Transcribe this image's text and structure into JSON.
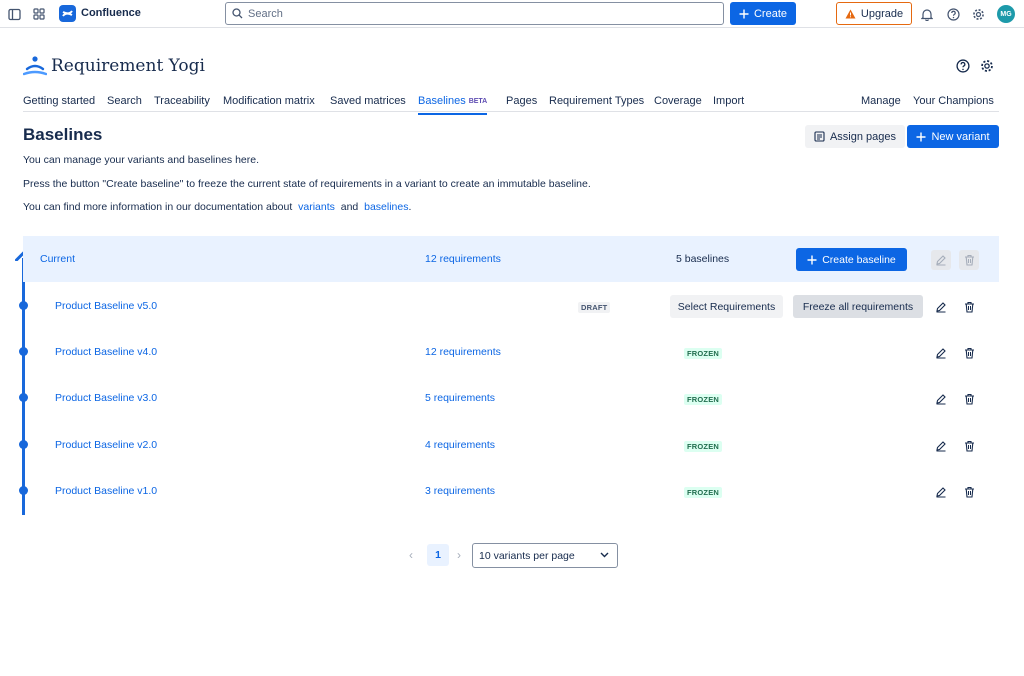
{
  "topbar": {
    "brand": "Confluence",
    "search_placeholder": "Search",
    "create_label": "Create",
    "upgrade_label": "Upgrade",
    "avatar_initials": "MG"
  },
  "app": {
    "name": "Requirement Yogi"
  },
  "tabs": [
    {
      "label": "Getting started"
    },
    {
      "label": "Search"
    },
    {
      "label": "Traceability"
    },
    {
      "label": "Modification matrix"
    },
    {
      "label": "Saved matrices"
    },
    {
      "label": "Baselines",
      "badge": "BETA",
      "active": true
    },
    {
      "label": "Pages"
    },
    {
      "label": "Requirement Types"
    },
    {
      "label": "Coverage"
    },
    {
      "label": "Import"
    },
    {
      "label": "Manage"
    },
    {
      "label": "Your Champions"
    }
  ],
  "page": {
    "title": "Baselines",
    "assign_pages_label": "Assign pages",
    "new_variant_label": "New variant",
    "intro_1": "You can manage your variants and baselines here.",
    "intro_2": "Press the button \"Create baseline\" to freeze the current state of requirements in a variant to create an immutable baseline.",
    "intro_3_prefix": "You can find more information in our documentation about",
    "intro_3_link1": "variants",
    "intro_3_and": "and",
    "intro_3_link2": "baselines",
    "intro_3_suffix": "."
  },
  "current": {
    "name": "Current",
    "requirements": "12 requirements",
    "baselines": "5 baselines",
    "create_baseline_label": "Create baseline"
  },
  "baselines": [
    {
      "name": "Product Baseline v5.0",
      "requirements": "",
      "status": "DRAFT",
      "select_label": "Select Requirements",
      "freeze_label": "Freeze all requirements"
    },
    {
      "name": "Product Baseline v4.0",
      "requirements": "12 requirements",
      "status": "FROZEN"
    },
    {
      "name": "Product Baseline v3.0",
      "requirements": "5 requirements",
      "status": "FROZEN"
    },
    {
      "name": "Product Baseline v2.0",
      "requirements": "4 requirements",
      "status": "FROZEN"
    },
    {
      "name": "Product Baseline v1.0",
      "requirements": "3 requirements",
      "status": "FROZEN"
    }
  ],
  "pagination": {
    "prev": "‹",
    "page": "1",
    "next": "›",
    "per_page": "10 variants per page"
  },
  "colors": {
    "accent": "#0c66e4",
    "current_row_bg": "#e9f2ff",
    "frozen_bg": "#dcfff1",
    "frozen_text": "#216e4e",
    "upgrade_border": "#e56910"
  }
}
